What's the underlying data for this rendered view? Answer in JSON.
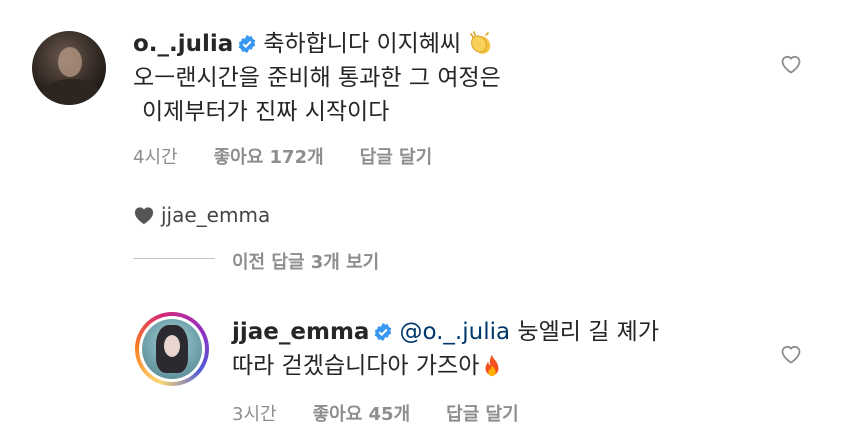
{
  "comment1": {
    "username": "o._.julia",
    "line1_text": "축하합니다 이지혜씨",
    "line2": "오ㅡ랜시간을 준비해 통과한 그 여정은",
    "line3": "이제부터가 진짜 시작이다",
    "time": "4시간",
    "likes": "좋아요 172개",
    "reply": "답글 달기",
    "emoji": "clapping-hands-icon"
  },
  "creator_like": {
    "username": "jjae_emma",
    "icon": "heart-filled-icon"
  },
  "view_replies": "이전 답글 3개 보기",
  "comment2": {
    "username": "jjae_emma",
    "mention": "@o._.julia",
    "line1_text": "눙엘리 길 졔가",
    "line2": "따라 걷겠습니다아 가즈아",
    "time": "3시간",
    "likes": "좋아요 45개",
    "reply": "답글 달기",
    "emoji": "fire-icon"
  },
  "colors": {
    "verified": "#3897f0",
    "mention": "#00376b",
    "meta": "#8e8e8e"
  }
}
